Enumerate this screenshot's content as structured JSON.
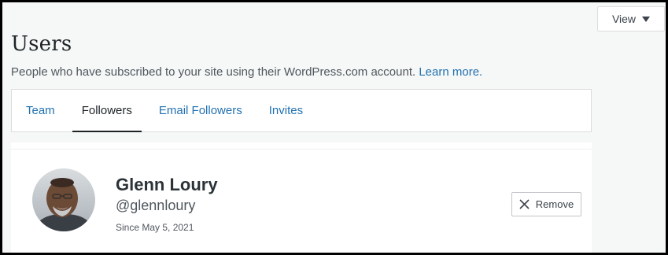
{
  "toolbar": {
    "view_label": "View"
  },
  "header": {
    "title": "Users",
    "subtitle": "People who have subscribed to your site using their WordPress.com account.",
    "learn_more": "Learn more."
  },
  "tabs": [
    {
      "label": "Team",
      "selected": false
    },
    {
      "label": "Followers",
      "selected": true
    },
    {
      "label": "Email Followers",
      "selected": false
    },
    {
      "label": "Invites",
      "selected": false
    }
  ],
  "follower": {
    "name": "Glenn Loury",
    "handle": "@glennloury",
    "since": "Since May 5, 2021",
    "remove_label": "Remove",
    "icons": {
      "remove": "close-icon",
      "view": "caret-down-icon"
    }
  },
  "colors": {
    "link": "#2271b1",
    "text": "#1d2327",
    "background": "#f6f7f7"
  }
}
